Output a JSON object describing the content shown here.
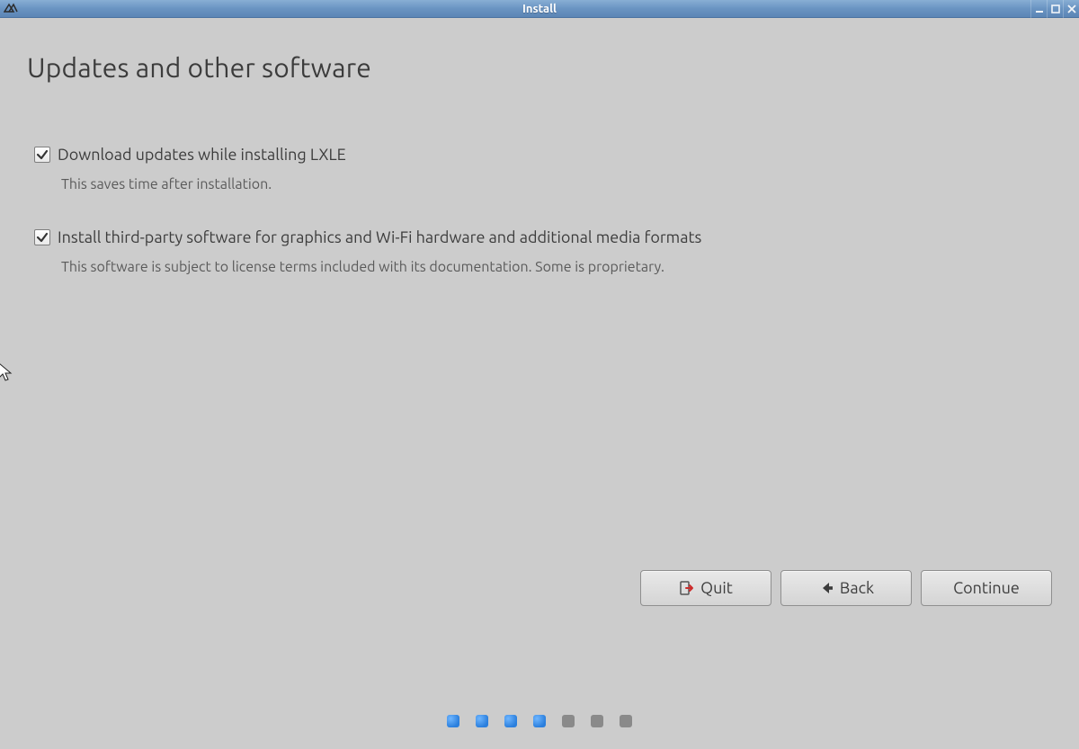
{
  "window": {
    "title": "Install"
  },
  "page": {
    "title": "Updates and other software"
  },
  "options": {
    "download_updates": {
      "checked": true,
      "label": "Download updates while installing LXLE",
      "description": "This saves time after installation."
    },
    "third_party": {
      "checked": true,
      "label": "Install third-party software for graphics and Wi-Fi hardware and additional media formats",
      "description": "This software is subject to license terms included with its documentation. Some is proprietary."
    }
  },
  "buttons": {
    "quit": "Quit",
    "back": "Back",
    "continue": "Continue"
  },
  "progress": {
    "total_steps": 7,
    "completed_steps": 4
  }
}
